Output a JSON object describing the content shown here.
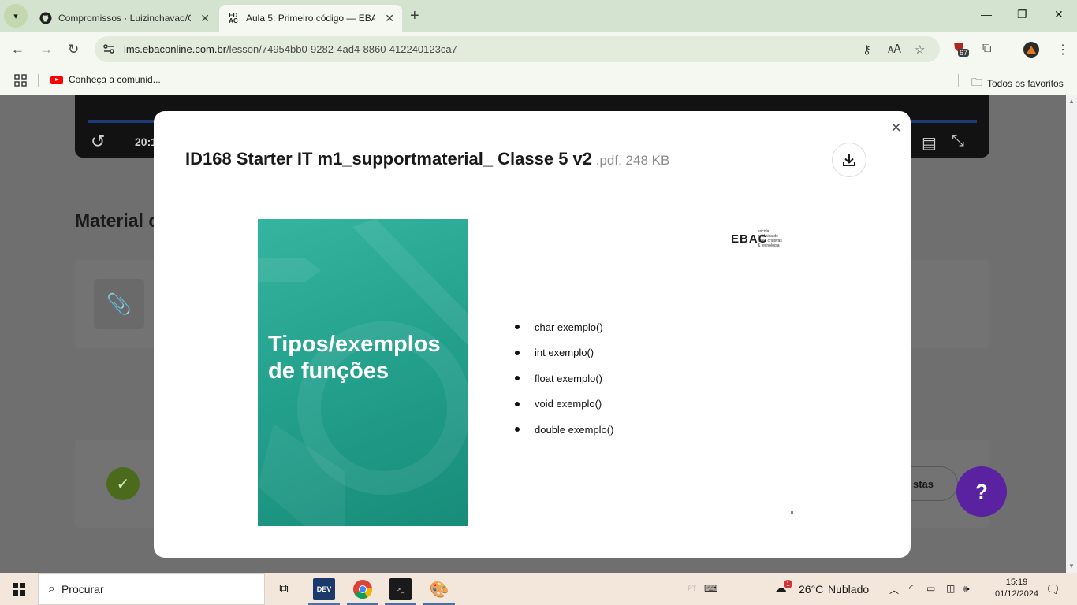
{
  "browser": {
    "tabs": [
      {
        "title": "Compromissos · Luizinchavao/C",
        "icon": "github-icon",
        "active": false
      },
      {
        "title": "Aula 5: Primeiro código — EBAC",
        "icon": "ebac-icon",
        "active": true
      }
    ],
    "new_tab": "+",
    "url_host": "lms.ebaconline.com.br",
    "url_path": "/lesson/74954bb0-9282-4ad4-8860-412240123ca7",
    "extension_badge": "67",
    "bookmarks": [
      {
        "label": "Conheça a comunid...",
        "icon": "youtube-icon"
      }
    ],
    "all_bookmarks_label": "Todos os favoritos"
  },
  "page": {
    "video_time": "20:1",
    "material_title": "Material c",
    "respostas_label": "stas",
    "help_label": "?",
    "accent_color": "#5a22a0"
  },
  "modal": {
    "title": "ID168 Starter IT m1_supportmaterial_ Classe 5 v2",
    "meta": " .pdf, 248 KB",
    "close_label": "×",
    "pdf": {
      "cover_text_line1": "Tipos/exemplos",
      "cover_text_line2": "de funções",
      "logo_mark": "EBAC",
      "logo_text": [
        "escola",
        "britânica de",
        "artes criativas",
        "& tecnologia"
      ],
      "bullets": [
        "char exemplo()",
        "int exemplo()",
        "float exemplo()",
        "void exemplo()",
        "double exemplo()"
      ]
    }
  },
  "taskbar": {
    "search_placeholder": "Procurar",
    "weather_temp": "26°C",
    "weather_desc": "Nublado",
    "weather_badge": "1",
    "time": "15:19",
    "date": "01/12/2024",
    "dev_label": "DEV"
  }
}
